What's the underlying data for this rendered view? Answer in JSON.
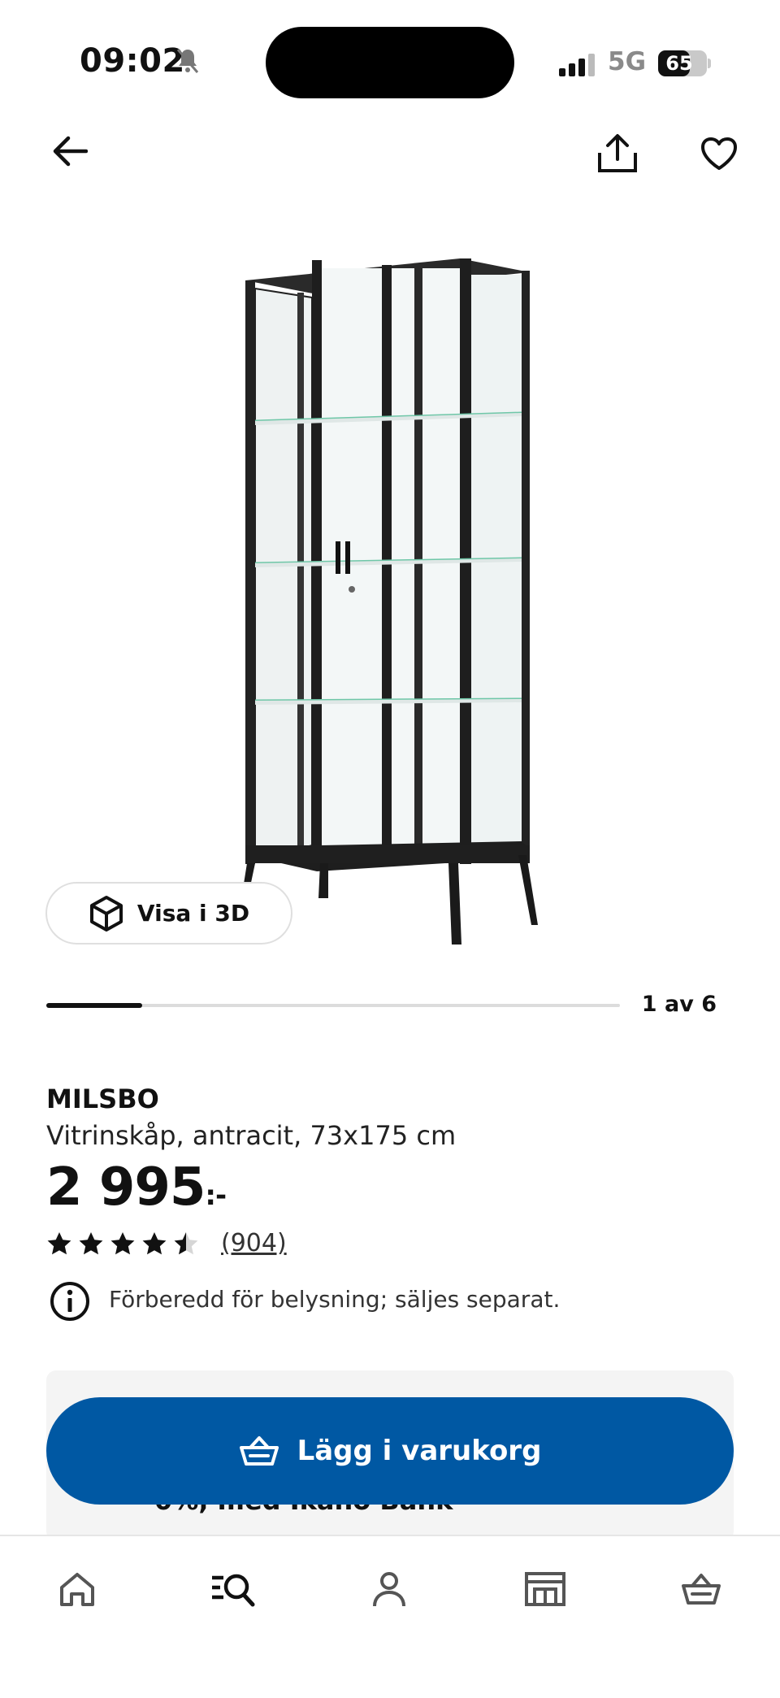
{
  "status_bar": {
    "time": "09:02",
    "network": "5G",
    "battery": "65",
    "battery_level": 0.65
  },
  "gallery": {
    "view_3d_label": "Visa i 3D",
    "counter": "1 av 6",
    "progress": 0.167
  },
  "product": {
    "name": "MILSBO",
    "description": "Vitrinskåp, antracit, 73x175 cm",
    "price": "2 995",
    "price_suffix": ":-",
    "rating": 4.5,
    "reviews": "(904)",
    "info": "Förberedd för belysning; säljes separat."
  },
  "buy": {
    "add_to_cart_label": "Lägg i varukorg",
    "financing_text": "0%, med Ikano Bank"
  },
  "colors": {
    "ikea_blue": "#0058a3",
    "text": "#111111"
  },
  "icons": {
    "back": "arrow-left-icon",
    "share": "share-icon",
    "favorite": "heart-icon",
    "view3d": "cube-icon",
    "info": "info-icon",
    "basket": "basket-icon",
    "tabs": [
      "home-icon",
      "search-icon",
      "profile-icon",
      "store-icon",
      "basket-icon"
    ]
  }
}
